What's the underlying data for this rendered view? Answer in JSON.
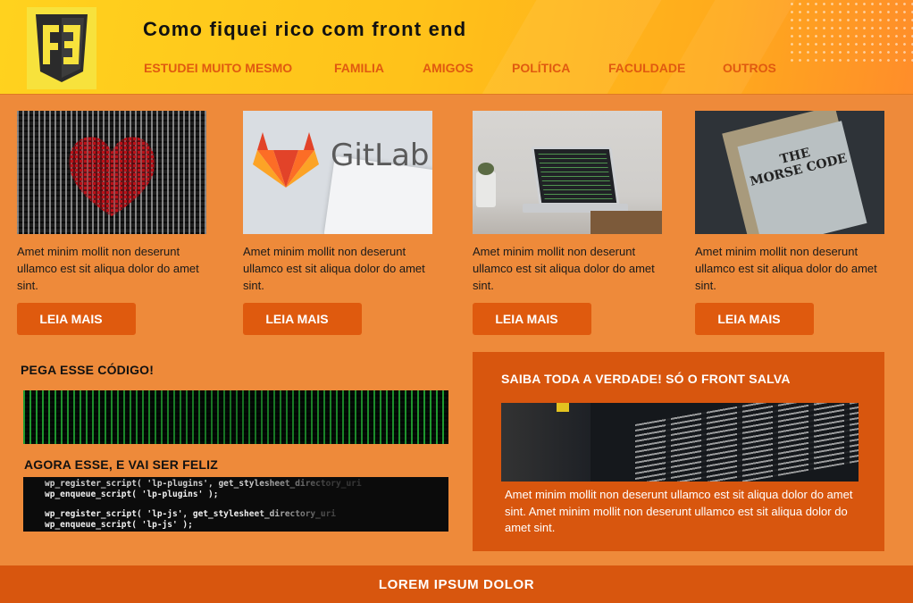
{
  "header": {
    "title": "Como fiquei rico com front end",
    "nav": [
      "ESTUDEI MUITO MESMO",
      "FAMILIA",
      "AMIGOS",
      "POLÍTICA",
      "FACULDADE",
      "OUTROS"
    ]
  },
  "cards": [
    {
      "image": "binary-heart",
      "text": "Amet minim mollit non deserunt ullamco est sit aliqua dolor do amet sint.",
      "button": "LEIA MAIS"
    },
    {
      "image": "gitlab-logo",
      "logo_text": "GitLab",
      "text": "Amet minim mollit non deserunt ullamco est sit aliqua dolor do amet sint.",
      "button": "LEIA MAIS"
    },
    {
      "image": "laptop-code",
      "text": "Amet minim mollit non deserunt ullamco est sit aliqua dolor do amet sint.",
      "button": "LEIA MAIS"
    },
    {
      "image": "morse-code-book",
      "book_text": [
        "THE",
        "MORSE CODE"
      ],
      "text": "Amet minim mollit non deserunt ullamco est sit aliqua dolor do amet sint.",
      "button": "LEIA MAIS"
    }
  ],
  "left": {
    "heading1": "PEGA ESSE CÓDIGO!",
    "heading2": "AGORA ESSE, E VAI SER FELIZ",
    "code_lines": [
      "wp_register_script( 'lp-plugins', get_stylesheet_directory_uri",
      "wp_enqueue_script( 'lp-plugins' );",
      "wp_register_script( 'lp-js', get_stylesheet_directory_uri",
      "wp_enqueue_script( 'lp-js' );"
    ]
  },
  "panel": {
    "heading": "SAIBA TODA A VERDADE! SÓ O FRONT SALVA",
    "text": "Amet minim mollit non deserunt ullamco est sit aliqua dolor do amet sint. Amet minim mollit non deserunt ullamco est sit aliqua dolor do amet sint."
  },
  "footer": {
    "text": "LOREM IPSUM DOLOR"
  },
  "colors": {
    "accent": "#df5a0e",
    "background": "#ee8a3a",
    "header_yellow": "#ffc21a",
    "panel": "#d8560e"
  }
}
